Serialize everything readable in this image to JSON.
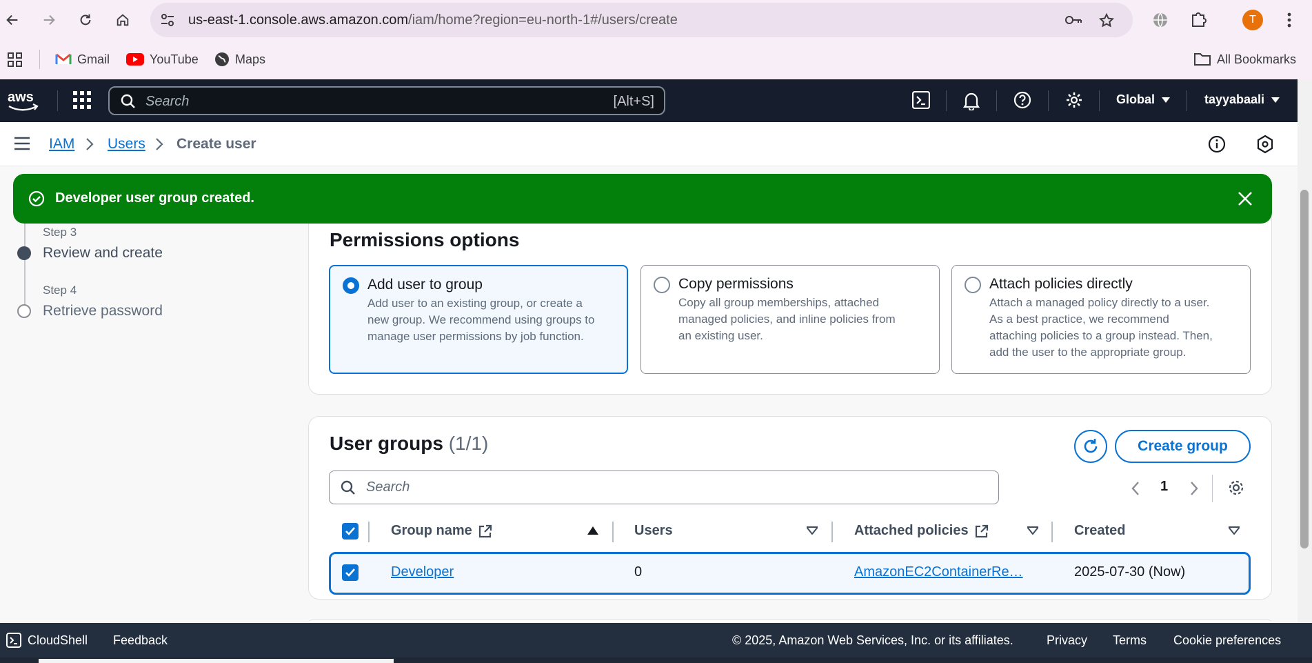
{
  "browser": {
    "url_host": "us-east-1.console.aws.amazon.com",
    "url_path": "/iam/home?region=eu-north-1#/users/create",
    "profile_initial": "T",
    "bookmarks": [
      "Gmail",
      "YouTube",
      "Maps"
    ],
    "all_bookmarks": "All Bookmarks"
  },
  "aws_nav": {
    "search_placeholder": "Search",
    "search_shortcut": "[Alt+S]",
    "region": "Global",
    "account": "tayyabaali"
  },
  "breadcrumb": [
    "IAM",
    "Users",
    "Create user"
  ],
  "flash": {
    "message": "Developer user group created.",
    "color": "#037f0c"
  },
  "steps": [
    {
      "label": "Step 3",
      "title": "Review and create"
    },
    {
      "label": "Step 4",
      "title": "Retrieve password"
    }
  ],
  "permissions": {
    "heading": "Permissions options",
    "options": [
      {
        "title": "Add user to group",
        "desc": "Add user to an existing group, or create a\nnew group. We recommend using groups to\nmanage user permissions by job function.",
        "selected": true
      },
      {
        "title": "Copy permissions",
        "desc": "Copy all group memberships, attached\nmanaged policies, and inline policies from\nan existing user.",
        "selected": false
      },
      {
        "title": "Attach policies directly",
        "desc": "Attach a managed policy directly to a user.\nAs a best practice, we recommend\nattaching policies to a group instead. Then,\nadd the user to the appropriate group.",
        "selected": false
      }
    ]
  },
  "user_groups": {
    "heading": "User groups",
    "count": "(1/1)",
    "create_button": "Create group",
    "search_placeholder": "Search",
    "page": "1",
    "columns": [
      "Group name",
      "Users",
      "Attached policies",
      "Created"
    ],
    "rows": [
      {
        "group_name": "Developer",
        "users": "0",
        "policies": "AmazonEC2ContainerRe…",
        "created": "2025-07-30 (Now)",
        "selected": true
      }
    ]
  },
  "footer": {
    "cloudshell": "CloudShell",
    "feedback": "Feedback",
    "copyright": "© 2025, Amazon Web Services, Inc. or its affiliates.",
    "links": [
      "Privacy",
      "Terms",
      "Cookie preferences"
    ]
  },
  "colors": {
    "accent": "#0972d3",
    "nav_bg": "#161e2d",
    "footer_bg": "#232f3e"
  }
}
